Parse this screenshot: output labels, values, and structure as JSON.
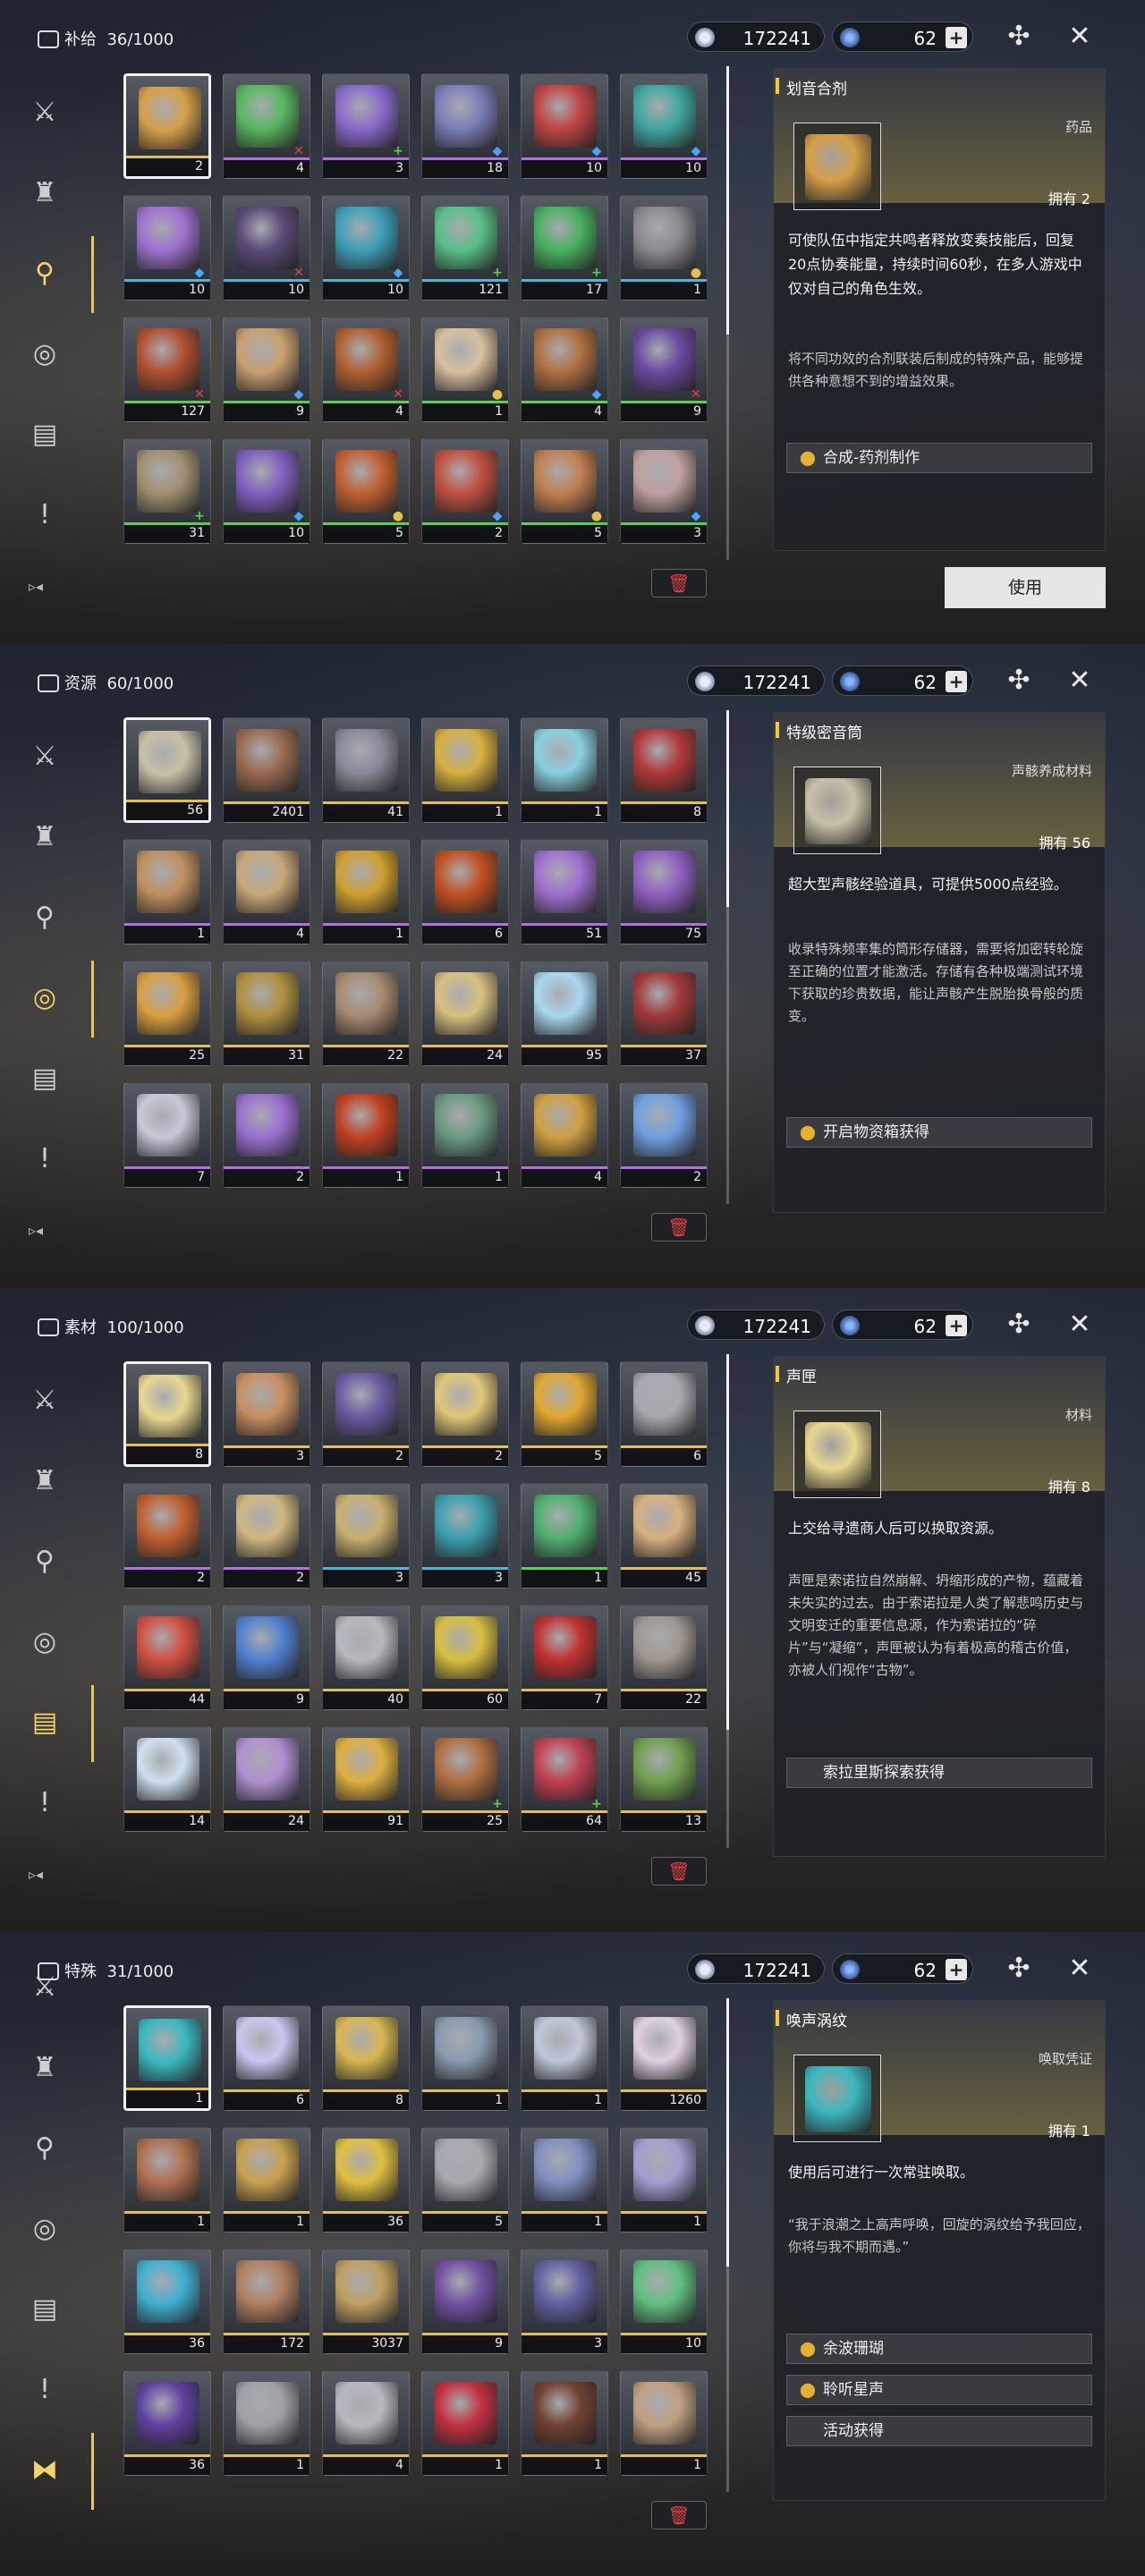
{
  "panels": [
    {
      "category": "补给",
      "capacity": "36/1000",
      "coins": "172241",
      "stars": "62",
      "items": [
        {
          "count": "2",
          "rarity": "#e5c14a",
          "color": "#d6a048",
          "badge": ""
        },
        {
          "count": "4",
          "rarity": "#b46ee6",
          "color": "#58b860",
          "badge": "✕"
        },
        {
          "count": "3",
          "rarity": "#b46ee6",
          "color": "#8a6acb",
          "badge": "+"
        },
        {
          "count": "18",
          "rarity": "#b46ee6",
          "color": "#7a7fb8",
          "badge": "◆"
        },
        {
          "count": "10",
          "rarity": "#b46ee6",
          "color": "#c04444",
          "badge": "◆"
        },
        {
          "count": "10",
          "rarity": "#b46ee6",
          "color": "#3ea8a0",
          "badge": "◆"
        },
        {
          "count": "10",
          "rarity": "#4ab8d8",
          "color": "#a070d0",
          "badge": "◆"
        },
        {
          "count": "10",
          "rarity": "#4ab8d8",
          "color": "#5a4a78",
          "badge": "✕"
        },
        {
          "count": "10",
          "rarity": "#4ab8d8",
          "color": "#3ca0b8",
          "badge": "◆"
        },
        {
          "count": "121",
          "rarity": "#4ab8d8",
          "color": "#58c088",
          "badge": "+"
        },
        {
          "count": "17",
          "rarity": "#4ab8d8",
          "color": "#48b060",
          "badge": "+"
        },
        {
          "count": "1",
          "rarity": "#4ab8d8",
          "color": "#8a8a90",
          "badge": "●"
        },
        {
          "count": "127",
          "rarity": "#58d24a",
          "color": "#b05030",
          "badge": "✕"
        },
        {
          "count": "9",
          "rarity": "#58d24a",
          "color": "#c8a070",
          "badge": "◆"
        },
        {
          "count": "4",
          "rarity": "#58d24a",
          "color": "#b06030",
          "badge": "✕"
        },
        {
          "count": "1",
          "rarity": "#58d24a",
          "color": "#d8c0a0",
          "badge": "●"
        },
        {
          "count": "4",
          "rarity": "#58d24a",
          "color": "#b07040",
          "badge": "◆"
        },
        {
          "count": "9",
          "rarity": "#58d24a",
          "color": "#6a4aa0",
          "badge": "✕"
        },
        {
          "count": "31",
          "rarity": "#58d24a",
          "color": "#a09070",
          "badge": "+"
        },
        {
          "count": "10",
          "rarity": "#58d24a",
          "color": "#8060c0",
          "badge": "◆"
        },
        {
          "count": "5",
          "rarity": "#58d24a",
          "color": "#c06030",
          "badge": "●"
        },
        {
          "count": "2",
          "rarity": "#58d24a",
          "color": "#c05040",
          "badge": "◆"
        },
        {
          "count": "5",
          "rarity": "#58d24a",
          "color": "#c08050",
          "badge": "●"
        },
        {
          "count": "3",
          "rarity": "#58d24a",
          "color": "#c0a0a0",
          "badge": "◆"
        }
      ],
      "detail": {
        "name": "划音合剂",
        "type": "药品",
        "own": "拥有 2",
        "desc": "可使队伍中指定共鸣者释放变奏技能后，回复20点协奏能量，持续时间60秒，在多人游戏中仅对自己的角色生效。",
        "lore": "将不同功效的合剂联装后制成的特殊产品，能够提供各种意想不到的增益效果。",
        "sources": [
          {
            "label": "合成-药剂制作",
            "pin": true
          }
        ],
        "use_label": "使用"
      }
    },
    {
      "category": "资源",
      "capacity": "60/1000",
      "coins": "172241",
      "stars": "62",
      "items": [
        {
          "count": "56",
          "rarity": "#e5c14a",
          "color": "#c8c0a8",
          "badge": ""
        },
        {
          "count": "2401",
          "rarity": "#e5c14a",
          "color": "#9a6a50",
          "badge": ""
        },
        {
          "count": "41",
          "rarity": "#e5c14a",
          "color": "#8a8a9a",
          "badge": ""
        },
        {
          "count": "1",
          "rarity": "#e5c14a",
          "color": "#d8b040",
          "badge": ""
        },
        {
          "count": "1",
          "rarity": "#e5c14a",
          "color": "#8ad0e0",
          "badge": ""
        },
        {
          "count": "8",
          "rarity": "#e5c14a",
          "color": "#b03838",
          "badge": ""
        },
        {
          "count": "1",
          "rarity": "#b46ee6",
          "color": "#c09060",
          "badge": ""
        },
        {
          "count": "4",
          "rarity": "#b46ee6",
          "color": "#c8a878",
          "badge": ""
        },
        {
          "count": "1",
          "rarity": "#b46ee6",
          "color": "#d0a030",
          "badge": ""
        },
        {
          "count": "6",
          "rarity": "#b46ee6",
          "color": "#c05020",
          "badge": ""
        },
        {
          "count": "51",
          "rarity": "#b46ee6",
          "color": "#a070d0",
          "badge": ""
        },
        {
          "count": "75",
          "rarity": "#b46ee6",
          "color": "#9060c0",
          "badge": ""
        },
        {
          "count": "25",
          "rarity": "#e5c14a",
          "color": "#d8a040",
          "badge": ""
        },
        {
          "count": "31",
          "rarity": "#e5c14a",
          "color": "#b09040",
          "badge": ""
        },
        {
          "count": "22",
          "rarity": "#e5c14a",
          "color": "#a88a70",
          "badge": ""
        },
        {
          "count": "24",
          "rarity": "#e5c14a",
          "color": "#d8c080",
          "badge": ""
        },
        {
          "count": "95",
          "rarity": "#e5c14a",
          "color": "#a8d8f0",
          "badge": ""
        },
        {
          "count": "37",
          "rarity": "#e5c14a",
          "color": "#a03838",
          "badge": ""
        },
        {
          "count": "7",
          "rarity": "#b46ee6",
          "color": "#c8c8d8",
          "badge": ""
        },
        {
          "count": "2",
          "rarity": "#b46ee6",
          "color": "#9a70d0",
          "badge": ""
        },
        {
          "count": "1",
          "rarity": "#b46ee6",
          "color": "#c04020",
          "badge": ""
        },
        {
          "count": "1",
          "rarity": "#b46ee6",
          "color": "#6a9a80",
          "badge": ""
        },
        {
          "count": "4",
          "rarity": "#b46ee6",
          "color": "#d0a040",
          "badge": ""
        },
        {
          "count": "2",
          "rarity": "#b46ee6",
          "color": "#70a0e0",
          "badge": ""
        }
      ],
      "detail": {
        "name": "特级密音筒",
        "type": "声骸养成材料",
        "own": "拥有 56",
        "desc": "超大型声骸经验道具，可提供5000点经验。",
        "lore": "收录特殊频率集的筒形存储器，需要将加密转轮旋至正确的位置才能激活。存储有各种极端测试环境下获取的珍贵数据，能让声骸产生脱胎换骨般的质变。",
        "sources": [
          {
            "label": "开启物资箱获得",
            "pin": true
          }
        ],
        "use_label": ""
      }
    },
    {
      "category": "素材",
      "capacity": "100/1000",
      "coins": "172241",
      "stars": "62",
      "items": [
        {
          "count": "8",
          "rarity": "#e5c14a",
          "color": "#e8d890",
          "badge": ""
        },
        {
          "count": "3",
          "rarity": "#e5c14a",
          "color": "#c89060",
          "badge": ""
        },
        {
          "count": "2",
          "rarity": "#e5c14a",
          "color": "#6a5aa0",
          "badge": ""
        },
        {
          "count": "2",
          "rarity": "#e5c14a",
          "color": "#e0c878",
          "badge": ""
        },
        {
          "count": "5",
          "rarity": "#e5c14a",
          "color": "#e0a830",
          "badge": ""
        },
        {
          "count": "6",
          "rarity": "#e5c14a",
          "color": "#a8a8b0",
          "badge": ""
        },
        {
          "count": "2",
          "rarity": "#b46ee6",
          "color": "#c06030",
          "badge": ""
        },
        {
          "count": "2",
          "rarity": "#b46ee6",
          "color": "#d0b880",
          "badge": ""
        },
        {
          "count": "3",
          "rarity": "#4ab8d8",
          "color": "#c8b070",
          "badge": ""
        },
        {
          "count": "3",
          "rarity": "#4ab8d8",
          "color": "#3aa0b0",
          "badge": ""
        },
        {
          "count": "1",
          "rarity": "#58d24a",
          "color": "#50b070",
          "badge": ""
        },
        {
          "count": "45",
          "rarity": "#e5c14a",
          "color": "#d8b080",
          "badge": ""
        },
        {
          "count": "44",
          "rarity": "#e5c14a",
          "color": "#d05040",
          "badge": ""
        },
        {
          "count": "9",
          "rarity": "#e5c14a",
          "color": "#5080d0",
          "badge": ""
        },
        {
          "count": "40",
          "rarity": "#e5c14a",
          "color": "#b8b8c0",
          "badge": ""
        },
        {
          "count": "60",
          "rarity": "#e5c14a",
          "color": "#d8c040",
          "badge": ""
        },
        {
          "count": "7",
          "rarity": "#e5c14a",
          "color": "#c03030",
          "badge": ""
        },
        {
          "count": "22",
          "rarity": "#e5c14a",
          "color": "#a09890",
          "badge": ""
        },
        {
          "count": "14",
          "rarity": "#e5c14a",
          "color": "#d0e0f0",
          "badge": ""
        },
        {
          "count": "24",
          "rarity": "#e5c14a",
          "color": "#b090d0",
          "badge": ""
        },
        {
          "count": "91",
          "rarity": "#e5c14a",
          "color": "#e0b040",
          "badge": ""
        },
        {
          "count": "25",
          "rarity": "#e5c14a",
          "color": "#b07040",
          "badge": "+"
        },
        {
          "count": "64",
          "rarity": "#e5c14a",
          "color": "#c04050",
          "badge": "+"
        },
        {
          "count": "13",
          "rarity": "#e5c14a",
          "color": "#70a050",
          "badge": ""
        }
      ],
      "detail": {
        "name": "声匣",
        "type": "材料",
        "own": "拥有 8",
        "desc": "上交给寻遗商人后可以换取资源。",
        "lore": "声匣是索诺拉自然崩解、坍缩形成的产物，蕴藏着未失实的过去。由于索诺拉是人类了解悲鸣历史与文明变迁的重要信息源，作为索诺拉的“碎片”与“凝缩”，声匣被认为有着极高的稽古价值，亦被人们视作“古物”。",
        "sources": [
          {
            "label": "索拉里斯探索获得",
            "pin": false
          }
        ],
        "use_label": ""
      }
    },
    {
      "category": "特殊",
      "capacity": "31/1000",
      "coins": "172241",
      "stars": "62",
      "items": [
        {
          "count": "1",
          "rarity": "#e5c14a",
          "color": "#3ab8c0",
          "badge": ""
        },
        {
          "count": "6",
          "rarity": "#e5c14a",
          "color": "#c8c8f0",
          "badge": ""
        },
        {
          "count": "8",
          "rarity": "#e5c14a",
          "color": "#d8b850",
          "badge": ""
        },
        {
          "count": "1",
          "rarity": "#e5c14a",
          "color": "#8a9ab0",
          "badge": ""
        },
        {
          "count": "1",
          "rarity": "#e5c14a",
          "color": "#c0c8d8",
          "badge": ""
        },
        {
          "count": "1260",
          "rarity": "#e5c14a",
          "color": "#e0d0e0",
          "badge": ""
        },
        {
          "count": "1",
          "rarity": "#e5c14a",
          "color": "#b07050",
          "badge": ""
        },
        {
          "count": "1",
          "rarity": "#e5c14a",
          "color": "#c8a050",
          "badge": ""
        },
        {
          "count": "36",
          "rarity": "#e5c14a",
          "color": "#e0c040",
          "badge": ""
        },
        {
          "count": "5",
          "rarity": "#e5c14a",
          "color": "#a8a8b0",
          "badge": ""
        },
        {
          "count": "1",
          "rarity": "#e5c14a",
          "color": "#8090c0",
          "badge": ""
        },
        {
          "count": "1",
          "rarity": "#e5c14a",
          "color": "#a0a0d0",
          "badge": ""
        },
        {
          "count": "36",
          "rarity": "#e5c14a",
          "color": "#40b0d0",
          "badge": ""
        },
        {
          "count": "172",
          "rarity": "#e5c14a",
          "color": "#b08060",
          "badge": ""
        },
        {
          "count": "3037",
          "rarity": "#e5c14a",
          "color": "#c0a060",
          "badge": ""
        },
        {
          "count": "9",
          "rarity": "#e5c14a",
          "color": "#7050a0",
          "badge": ""
        },
        {
          "count": "3",
          "rarity": "#e5c14a",
          "color": "#6060a0",
          "badge": ""
        },
        {
          "count": "10",
          "rarity": "#e5c14a",
          "color": "#60c080",
          "badge": ""
        },
        {
          "count": "36",
          "rarity": "#e5c14a",
          "color": "#6040a0",
          "badge": ""
        },
        {
          "count": "1",
          "rarity": "#e5c14a",
          "color": "#a0a0a8",
          "badge": ""
        },
        {
          "count": "4",
          "rarity": "#e5c14a",
          "color": "#b8b8c0",
          "badge": ""
        },
        {
          "count": "1",
          "rarity": "#e5c14a",
          "color": "#c03040",
          "badge": ""
        },
        {
          "count": "1",
          "rarity": "#e5c14a",
          "color": "#704030",
          "badge": ""
        },
        {
          "count": "1",
          "rarity": "#e5c14a",
          "color": "#c0a080",
          "badge": ""
        }
      ],
      "detail": {
        "name": "唤声涡纹",
        "type": "唤取凭证",
        "own": "拥有 1",
        "desc": "使用后可进行一次常驻唤取。",
        "lore": "“我于浪潮之上高声呼唤，回旋的涡纹给予我回应，你将与我不期而遇。”",
        "sources": [
          {
            "label": "余波珊瑚",
            "pin": true
          },
          {
            "label": "聆听星声",
            "pin": true
          },
          {
            "label": "活动获得",
            "pin": false
          }
        ],
        "use_label": ""
      }
    }
  ]
}
